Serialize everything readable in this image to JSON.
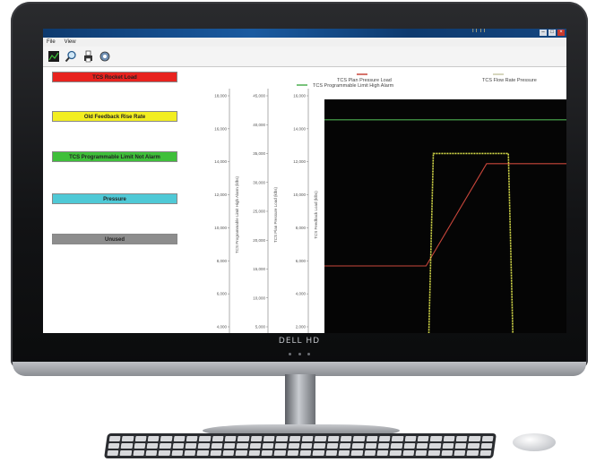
{
  "window": {
    "menu": [
      "File",
      "View"
    ],
    "titlebar_text": "TT TT"
  },
  "toolbar": {
    "icons": [
      "chart-icon",
      "magnify-icon",
      "print-icon",
      "settings-icon"
    ]
  },
  "status_buttons": [
    {
      "label": "TCS Rocket Load",
      "color": "#e8231f"
    },
    {
      "label": "Old Feedback Rise Rate",
      "color": "#f2ee21"
    },
    {
      "label": "TCS Programmable Limit Not Alarm",
      "color": "#3fbf3a"
    },
    {
      "label": "Pressure",
      "color": "#4fc9d6"
    },
    {
      "label": "Unused",
      "color": "#8d8d8d"
    }
  ],
  "legend": {
    "items": [
      {
        "label": "TCS Plan Pressure Load",
        "color": "#c9463b"
      },
      {
        "label": "TCS Flow Rate Pressure",
        "color": "#c9c9a8"
      },
      {
        "label": "TCS Programmable Limit High Alarm",
        "color": "#4caf50"
      }
    ]
  },
  "axes": {
    "left3_ticks": [
      "18,000",
      "16,000",
      "14,000",
      "12,000",
      "10,000",
      "8,000",
      "6,000",
      "4,000"
    ],
    "left2_ticks": [
      "45,000",
      "40,000",
      "35,000",
      "30,000",
      "25,000",
      "20,000",
      "15,000",
      "10,000",
      "5,000"
    ],
    "left1_ticks": [
      "16,000",
      "14,000",
      "12,000",
      "10,000",
      "8,000",
      "6,000",
      "4,000",
      "2,000"
    ],
    "left3_label": "TCS Programmable Limit High Alarm (klbs)",
    "left2_label": "TCS Plan Pressure Load (klbs)",
    "left1_label": "TCS Feedback Load (klbs)"
  },
  "chart_data": {
    "type": "line",
    "series": [
      {
        "name": "TCS Plan Pressure Load",
        "color": "#c9463b",
        "points": [
          [
            0,
            4.6
          ],
          [
            0.42,
            4.6
          ],
          [
            0.67,
            11.6
          ],
          [
            1.0,
            11.6
          ]
        ]
      },
      {
        "name": "TCS Flow Rate Pressure",
        "color": "#d8dd4a",
        "points": [
          [
            0,
            -1
          ],
          [
            0.43,
            -1
          ],
          [
            0.45,
            12.3
          ],
          [
            0.76,
            12.3
          ],
          [
            0.78,
            -1
          ],
          [
            1.0,
            -1
          ]
        ]
      },
      {
        "name": "TCS Programmable Limit High Alarm",
        "color": "#4caf50",
        "points": [
          [
            0,
            14.6
          ],
          [
            1.0,
            14.6
          ]
        ]
      }
    ],
    "ylim": [
      0,
      16
    ]
  },
  "monitor": {
    "brand": "DELL HD"
  }
}
